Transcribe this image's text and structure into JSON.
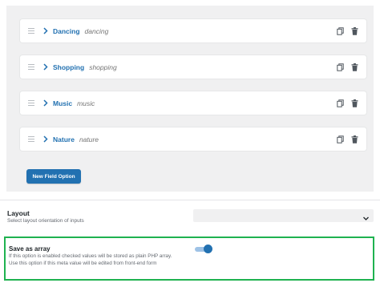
{
  "options": [
    {
      "label": "Dancing",
      "value": "dancing"
    },
    {
      "label": "Shopping",
      "value": "shopping"
    },
    {
      "label": "Music",
      "value": "music"
    },
    {
      "label": "Nature",
      "value": "nature"
    }
  ],
  "new_field_button": "New Field Option",
  "layout": {
    "title": "Layout",
    "description": "Select layout orientation of inputs",
    "selected": ""
  },
  "save_as_array": {
    "title": "Save as array",
    "description": "If this option is enabled checked values will be stored as plain PHP array. Use this option if this meta value will be edited from front-end form",
    "enabled": true
  },
  "colors": {
    "accent": "#2271b1",
    "highlight_border": "#1fb250",
    "panel_bg": "#f0f0f1"
  },
  "icons": [
    "drag-handle-icon",
    "chevron-right-icon",
    "copy-icon",
    "trash-icon",
    "chevron-down-icon"
  ]
}
